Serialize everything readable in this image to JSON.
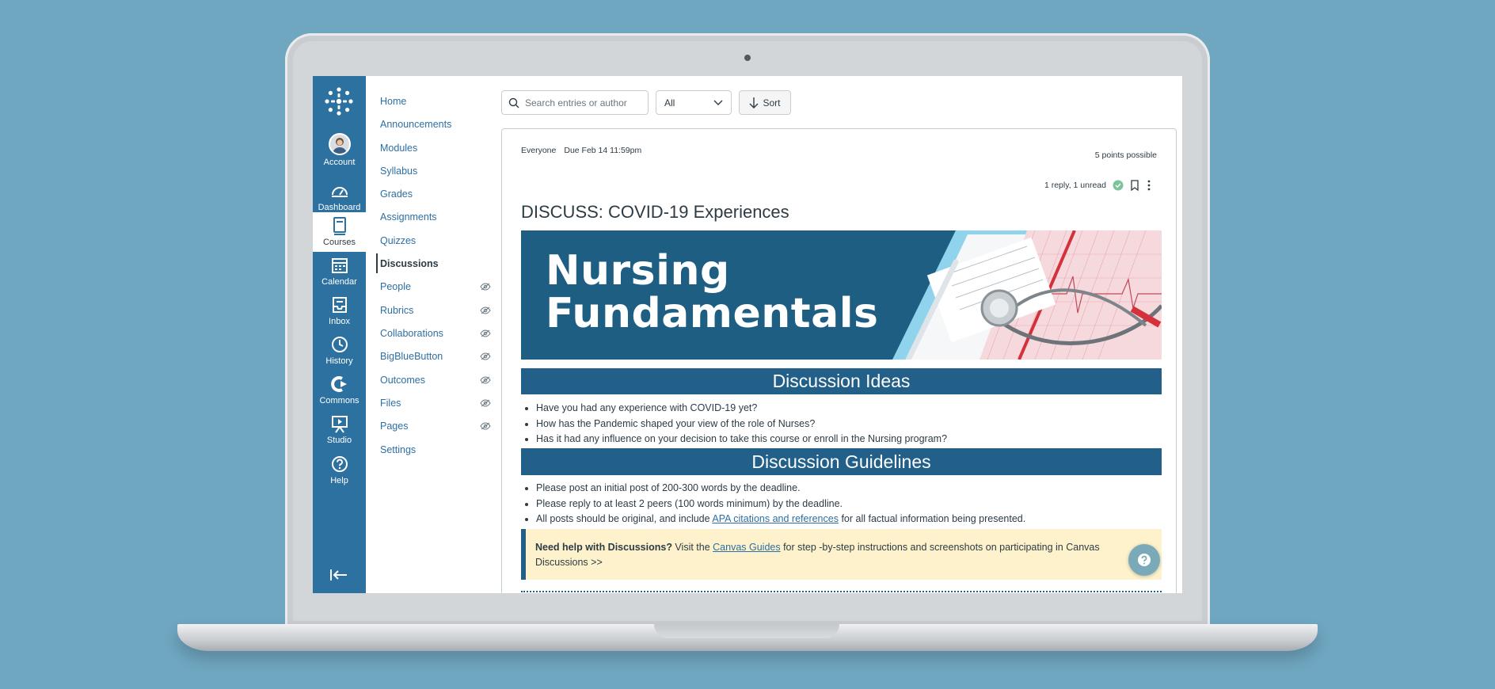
{
  "global_nav": {
    "items": [
      {
        "label": "Account",
        "icon": "account-avatar"
      },
      {
        "label": "Dashboard",
        "icon": "dashboard-icon"
      },
      {
        "label": "Courses",
        "icon": "courses-icon"
      },
      {
        "label": "Calendar",
        "icon": "calendar-icon"
      },
      {
        "label": "Inbox",
        "icon": "inbox-icon"
      },
      {
        "label": "History",
        "icon": "history-icon"
      },
      {
        "label": "Commons",
        "icon": "commons-icon"
      },
      {
        "label": "Studio",
        "icon": "studio-icon"
      },
      {
        "label": "Help",
        "icon": "help-icon"
      }
    ],
    "active": "Courses"
  },
  "course_nav": {
    "items": [
      {
        "label": "Home"
      },
      {
        "label": "Announcements"
      },
      {
        "label": "Modules"
      },
      {
        "label": "Syllabus"
      },
      {
        "label": "Grades"
      },
      {
        "label": "Assignments"
      },
      {
        "label": "Quizzes"
      },
      {
        "label": "Discussions"
      },
      {
        "label": "People"
      },
      {
        "label": "Rubrics"
      },
      {
        "label": "Collaborations"
      },
      {
        "label": "BigBlueButton"
      },
      {
        "label": "Outcomes"
      },
      {
        "label": "Files"
      },
      {
        "label": "Pages"
      },
      {
        "label": "Settings"
      }
    ],
    "active": "Discussions",
    "hidden_items": [
      "People",
      "Rubrics",
      "Collaborations",
      "BigBlueButton",
      "Outcomes",
      "Files",
      "Pages"
    ]
  },
  "toolbar": {
    "search_placeholder": "Search entries or author",
    "filter_value": "All",
    "sort_label": "Sort"
  },
  "discussion": {
    "audience": "Everyone",
    "due": "Due Feb 14 11:59pm",
    "points": "5 points possible",
    "replies": "1 reply, 1 unread",
    "title": "DISCUSS: COVID-19 Experiences",
    "banner_line1": "Nursing",
    "banner_line2": "Fundamentals",
    "ideas_heading": "Discussion Ideas",
    "ideas": [
      "Have you had any experience with COVID-19 yet?",
      "How has the Pandemic shaped your view of the role of Nurses?",
      "Has it had any influence on your decision to take this course or enroll in the Nursing program?"
    ],
    "guidelines_heading": "Discussion Guidelines",
    "guidelines": [
      "Please post an initial post of 200-300 words by the deadline.",
      "Please reply to at least 2 peers (100 words minimum) by the deadline."
    ],
    "guideline3_before": "All posts should be original, and include ",
    "guideline3_link": "APA citations and references",
    "guideline3_after": " for all factual information being presented.",
    "help_bold": "Need help with Discussions?",
    "help_before": " Visit the ",
    "help_link": "Canvas Guides",
    "help_after": " for step -by-step instructions and screenshots on participating in Canvas Discussions >>"
  },
  "colors": {
    "nav_blue": "#2d71a0",
    "heading_bar": "#236089",
    "link": "#2d6fa3",
    "help_bg": "#fdf2cc",
    "background": "#6fa6c0"
  }
}
